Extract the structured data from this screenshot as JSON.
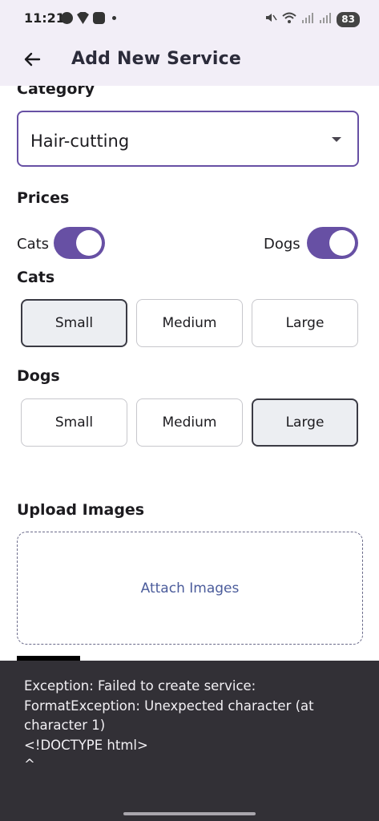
{
  "status_bar": {
    "time": "11:21",
    "battery": "83",
    "icons_left": [
      "message-icon",
      "brave-icon",
      "youtube-icon",
      "dot-icon"
    ],
    "icons_right": [
      "mute-icon",
      "wifi-icon",
      "signal-icon",
      "signal-icon",
      "battery-icon"
    ]
  },
  "app_bar": {
    "title": "Add New Service",
    "back_icon": "arrow-back-icon"
  },
  "category": {
    "label": "Category",
    "value": "Hair-cutting"
  },
  "prices": {
    "label": "Prices",
    "cats_toggle_label": "Cats",
    "dogs_toggle_label": "Dogs",
    "cats_enabled": true,
    "dogs_enabled": true
  },
  "cats": {
    "label": "Cats",
    "sizes": [
      "Small",
      "Medium",
      "Large"
    ],
    "selected": "Small"
  },
  "dogs": {
    "label": "Dogs",
    "sizes": [
      "Small",
      "Medium",
      "Large"
    ],
    "selected": "Large"
  },
  "upload": {
    "label": "Upload Images",
    "attach_label": "Attach Images"
  },
  "snackbar": {
    "message": "Exception: Failed to create service:\nFormatException: Unexpected character (at\ncharacter 1)\n<!DOCTYPE html>\n^"
  },
  "colors": {
    "accent": "#6750a4",
    "topbar": "#f2eef7",
    "snackbar": "#323036",
    "link": "#4b5c9b"
  }
}
